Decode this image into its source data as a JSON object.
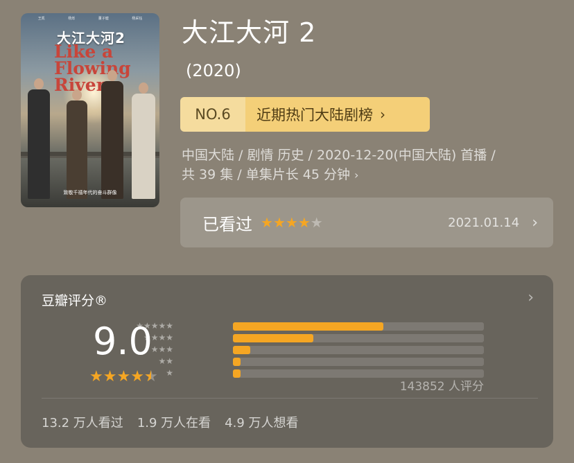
{
  "poster": {
    "title_cn": "大江大河2",
    "title_en": "Like a Flowing River",
    "tagline": "致敬千禧年代的奋斗群像",
    "actors": [
      "王凯",
      "杨烁",
      "董子健",
      "杨采钰"
    ]
  },
  "header": {
    "title": "大江大河 2",
    "year": "(2020)"
  },
  "ranking": {
    "number": "NO.6",
    "list_name": "近期热门大陆剧榜",
    "chevron_icon": "chevron-right-icon"
  },
  "meta": {
    "line1": "中国大陆 / 剧情 历史 / 2020-12-20(中国大陆) 首播 /",
    "line2": "共 39 集 / 单集片长 45 分钟",
    "chevron_icon": "chevron-right-icon"
  },
  "user_status": {
    "label": "已看过",
    "rating_stars": 4,
    "max_stars": 5,
    "date": "2021.01.14"
  },
  "douban_rating": {
    "title": "豆瓣评分®",
    "score": "9.0",
    "score_stars": 4.5,
    "distribution": [
      {
        "stars": 5,
        "label": "★★★★★",
        "fraction": 0.6
      },
      {
        "stars": 4,
        "label": "★★★★",
        "fraction": 0.32
      },
      {
        "stars": 3,
        "label": "★★★",
        "fraction": 0.07
      },
      {
        "stars": 2,
        "label": "★★",
        "fraction": 0.03
      },
      {
        "stars": 1,
        "label": "★",
        "fraction": 0.03
      }
    ],
    "rating_count": "143852 人评分",
    "watched": "13.2 万人看过",
    "watching": "1.9 万人在看",
    "want": "4.9 万人想看"
  },
  "colors": {
    "background": "#8a8275",
    "accent_star": "#f5a623",
    "rank_badge": "#f5dc9e",
    "rank_list": "#f4cf78",
    "rating_panel": "#68645c"
  }
}
